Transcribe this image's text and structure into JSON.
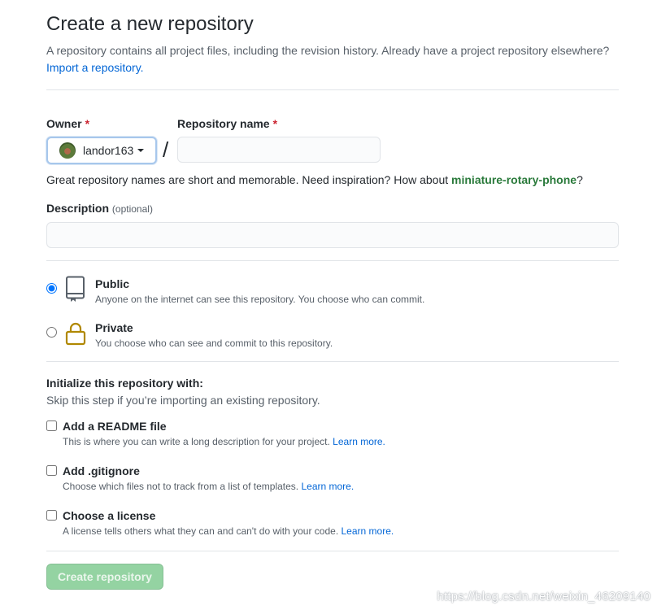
{
  "header": {
    "title": "Create a new repository",
    "subtitle": "A repository contains all project files, including the revision history. Already have a project repository elsewhere?",
    "import_link": "Import a repository."
  },
  "owner": {
    "label": "Owner",
    "required_mark": "*",
    "value": "landor163",
    "slash": "/"
  },
  "repo_name": {
    "label": "Repository name",
    "required_mark": "*",
    "value": ""
  },
  "hint": {
    "prefix": "Great repository names are short and memorable. Need inspiration? How about ",
    "suggestion": "miniature-rotary-phone",
    "suffix": "?"
  },
  "description": {
    "label": "Description",
    "optional": "(optional)",
    "value": ""
  },
  "visibility": {
    "selected": "public",
    "options": [
      {
        "id": "public",
        "title": "Public",
        "desc": "Anyone on the internet can see this repository. You choose who can commit.",
        "icon": "repo-book-icon"
      },
      {
        "id": "private",
        "title": "Private",
        "desc": "You choose who can see and commit to this repository.",
        "icon": "lock-icon"
      }
    ]
  },
  "initialize": {
    "title": "Initialize this repository with:",
    "subtitle": "Skip this step if you’re importing an existing repository.",
    "options": [
      {
        "title": "Add a README file",
        "desc": "This is where you can write a long description for your project.",
        "link": "Learn more.",
        "checked": false
      },
      {
        "title": "Add .gitignore",
        "desc": "Choose which files not to track from a list of templates.",
        "link": "Learn more.",
        "checked": false
      },
      {
        "title": "Choose a license",
        "desc": "A license tells others what they can and can't do with your code.",
        "link": "Learn more.",
        "checked": false
      }
    ]
  },
  "create_button": "Create repository",
  "watermark": "https://blog.csdn.net/weixin_46209140",
  "colors": {
    "link": "#0366d6",
    "suggestion": "#2a7a3b",
    "button_disabled": "#94d3a2",
    "required": "#cb2431"
  }
}
